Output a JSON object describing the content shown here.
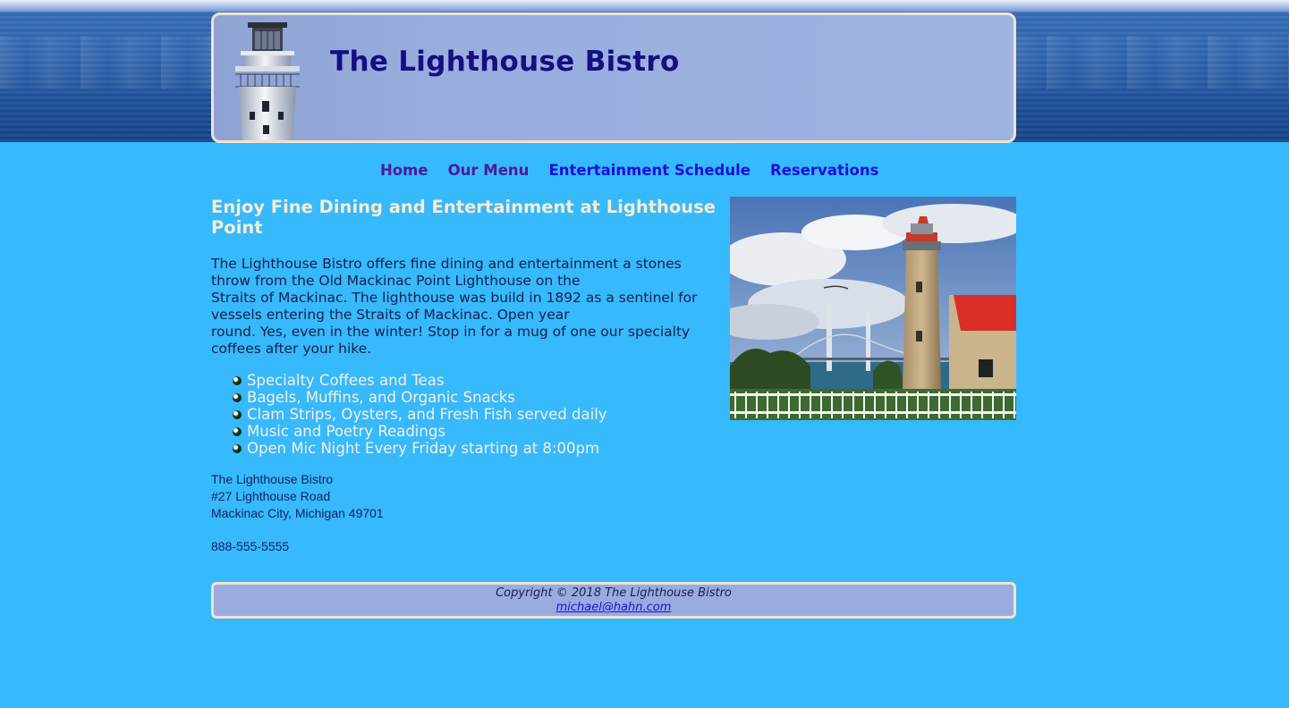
{
  "site": {
    "title": "The Lighthouse Bistro"
  },
  "nav": {
    "items": [
      {
        "label": "Home",
        "state": "visited"
      },
      {
        "label": "Our Menu",
        "state": "visited"
      },
      {
        "label": "Entertainment Schedule",
        "state": "unvisited"
      },
      {
        "label": "Reservations",
        "state": "unvisited"
      }
    ]
  },
  "main": {
    "heading": "Enjoy Fine Dining and Entertainment at Lighthouse Point",
    "intro_lines": [
      "The Lighthouse Bistro offers fine dining and entertainment a stones",
      "throw from the Old Mackinac Point Lighthouse on the",
      "Straits of Mackinac. The lighthouse was build in 1892 as a sentinel for",
      "vessels entering the Straits of Mackinac. Open year",
      "round. Yes, even in the winter! Stop in for a mug of one our specialty",
      "coffees after your hike."
    ],
    "features": [
      "Specialty Coffees and Teas",
      "Bagels, Muffins, and Organic Snacks",
      "Clam Strips, Oysters, and Fresh Fish served daily",
      "Music and Poetry Readings",
      "Open Mic Night Every Friday starting at 8:00pm"
    ],
    "address": {
      "name": "The Lighthouse Bistro",
      "street": "#27 Lighthouse Road",
      "city": "Mackinac City, Michigan 49701"
    },
    "phone": "888-555-5555"
  },
  "footer": {
    "copyright": "Copyright © 2018 The Lighthouse Bistro",
    "email": "michael@hahn.com"
  },
  "colors": {
    "background": "#37b9fd",
    "title": "#150e84",
    "heading": "#f7ecd2",
    "nav_visited": "#4c1aa0",
    "nav_unvisited": "#1a10d8"
  }
}
